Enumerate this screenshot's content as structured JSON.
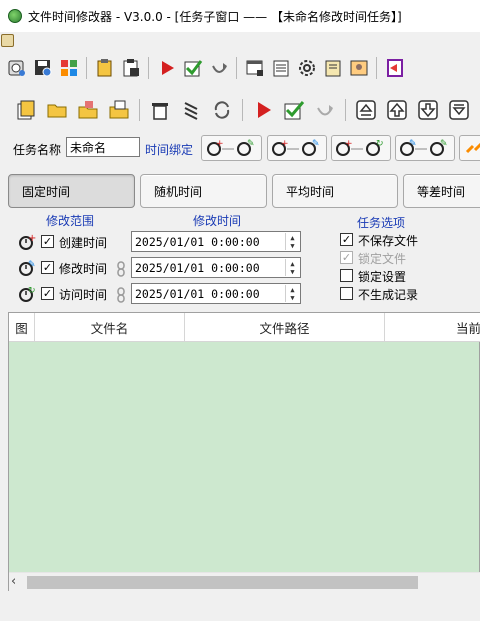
{
  "window": {
    "title": "文件时间修改器  - V3.0.0 - [任务子窗口 —— 【未命名修改时间任务】]"
  },
  "colors": {
    "link_blue": "#1a3bb5",
    "grid_bg": "#cde8cf",
    "run_red": "#d42020",
    "check_green": "#2e9b2e"
  },
  "toolbar_main": {
    "icons": [
      "settings-calc-icon",
      "save-disk-icon",
      "grid-apps-icon",
      "open-clipboard-icon",
      "save-clipboard-icon",
      "run-triangle-icon",
      "check-green-icon",
      "undo-curve-icon",
      "window-export-icon",
      "notes-icon",
      "gear-icon",
      "document-icon",
      "image-icon",
      "exit-icon"
    ]
  },
  "toolbar_task": {
    "icons": [
      "add-files-icon",
      "add-folder-icon",
      "add-folder-files-icon",
      "add-folder-files-2-icon",
      "delete-trash-icon",
      "clear-broom-icon",
      "refresh-icon",
      "run-triangle-icon",
      "check-green-icon",
      "undo-curve-icon",
      "move-top-icon",
      "move-up-icon",
      "move-down-icon",
      "move-bottom-icon"
    ]
  },
  "task": {
    "name_label": "任务名称",
    "name_value": "未命名",
    "bind_label": "时间绑定"
  },
  "tabs": [
    {
      "label": "固定时间",
      "active": true
    },
    {
      "label": "随机时间",
      "active": false
    },
    {
      "label": "平均时间",
      "active": false
    },
    {
      "label": "等差时间",
      "active": false
    }
  ],
  "sections": {
    "range": "修改范围",
    "time": "修改时间",
    "options": "任务选项"
  },
  "time_rows": [
    {
      "label": "创建时间",
      "checked": true,
      "value": "2025/01/01  0:00:00",
      "icon": "clock-add-icon"
    },
    {
      "label": "修改时间",
      "checked": true,
      "value": "2025/01/01  0:00:00",
      "icon": "clock-edit-icon"
    },
    {
      "label": "访问时间",
      "checked": true,
      "value": "2025/01/01  0:00:00",
      "icon": "clock-refresh-icon"
    }
  ],
  "task_options": [
    {
      "label": "不保存文件",
      "checked": true,
      "disabled": false
    },
    {
      "label": "锁定文件",
      "checked": true,
      "disabled": true
    },
    {
      "label": "锁定设置",
      "checked": false,
      "disabled": false
    },
    {
      "label": "不生成记录",
      "checked": false,
      "disabled": false
    }
  ],
  "table": {
    "columns": [
      "图",
      "文件名",
      "文件路径",
      "当前"
    ]
  }
}
